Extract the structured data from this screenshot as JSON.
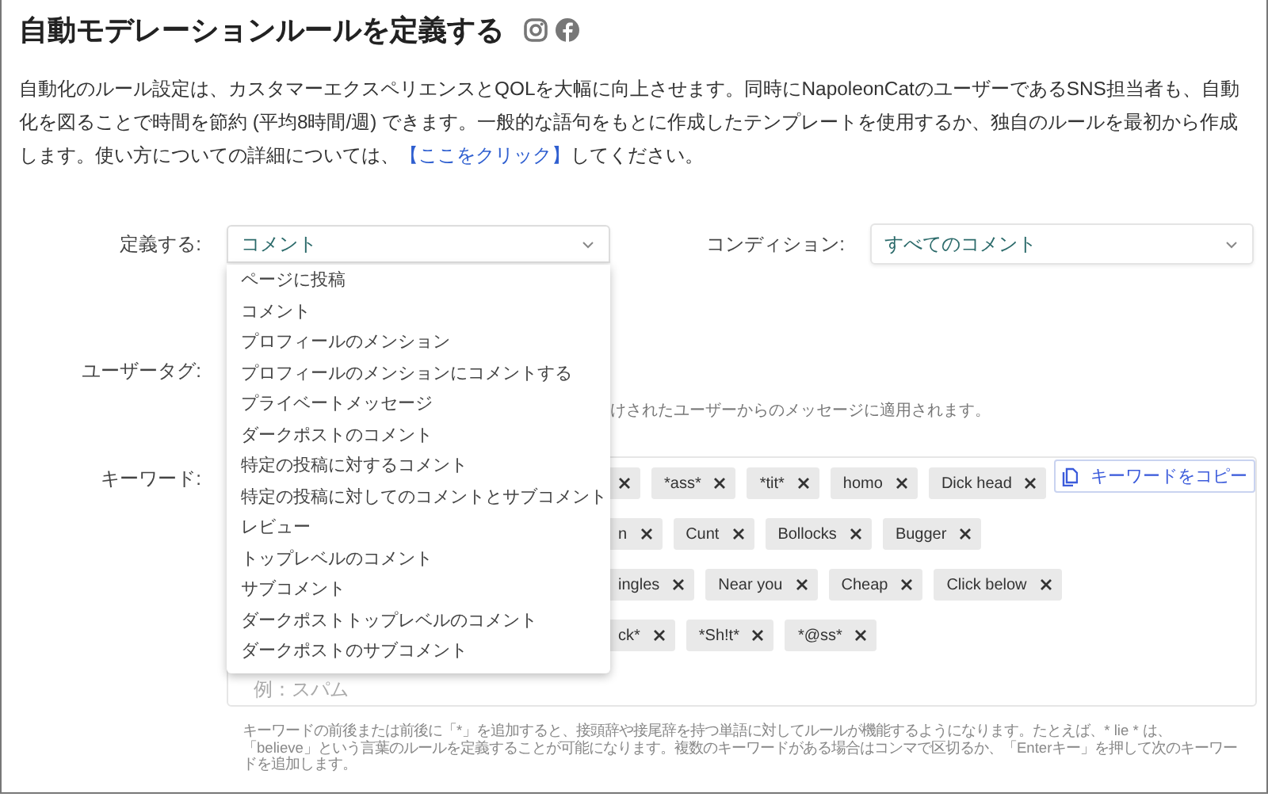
{
  "header": {
    "title": "自動モデレーションルールを定義する"
  },
  "description": {
    "text": "自動化のルール設定は、カスタマーエクスペリエンスとQOLを大幅に向上させます。同時にNapoleonCatのユーザーであるSNS担当者も、自動化を図ることで時間を節約 (平均8時間/週) できます。一般的な語句をもとに作成したテンプレートを使用するか、独自のルールを最初から作成します。使い方についての詳細については、",
    "link": "【ここをクリック】",
    "after": "してください。"
  },
  "define": {
    "label": "定義する:",
    "value": "コメント",
    "expanded": true,
    "options": [
      "ページに投稿",
      "コメント",
      "プロフィールのメンション",
      "プロフィールのメンションにコメントする",
      "プライベートメッセージ",
      "ダークポストのコメント",
      "特定の投稿に対するコメント",
      "特定の投稿に対してのコメントとサブコメント",
      "レビュー",
      "トップレベルのコメント",
      "サブコメント",
      "ダークポストトップレベルのコメント",
      "ダークポストのサブコメント"
    ]
  },
  "condition": {
    "label": "コンディション:",
    "value": "すべてのコメント"
  },
  "user_tags": {
    "label": "ユーザータグ:",
    "hint": "けされたユーザーからのメッセージに適用されます。"
  },
  "keywords": {
    "label": "キーワード:",
    "copy_button": "キーワードをコピー",
    "placeholder": "例：スパム",
    "tag_lines": [
      {
        "covered_tag": true,
        "tags": [
          {
            "text": "*ass*"
          },
          {
            "text": "*tit*"
          },
          {
            "text": "homo"
          },
          {
            "text": "Dick head"
          }
        ]
      },
      {
        "tags": [
          {
            "text": "n"
          },
          {
            "text": "Cunt"
          },
          {
            "text": "Bollocks"
          },
          {
            "text": "Bugger"
          }
        ]
      },
      {
        "tags": [
          {
            "text": "ingles"
          },
          {
            "text": "Near you"
          },
          {
            "text": "Cheap"
          },
          {
            "text": "Click below"
          }
        ]
      },
      {
        "tags": [
          {
            "text": "ck*"
          },
          {
            "text": "*Sh!t*"
          },
          {
            "text": "*@ss*"
          }
        ]
      }
    ],
    "help": "キーワードの前後または前後に「*」を追加すると、接頭辞や接尾辞を持つ単語に対してルールが機能するようになります。たとえば、* lie * は、「believe」という言葉のルールを定義することが可能になります。複数のキーワードがある場合はコンマで区切るか、「Enterキー」を押して次のキーワードを追加します。"
  }
}
